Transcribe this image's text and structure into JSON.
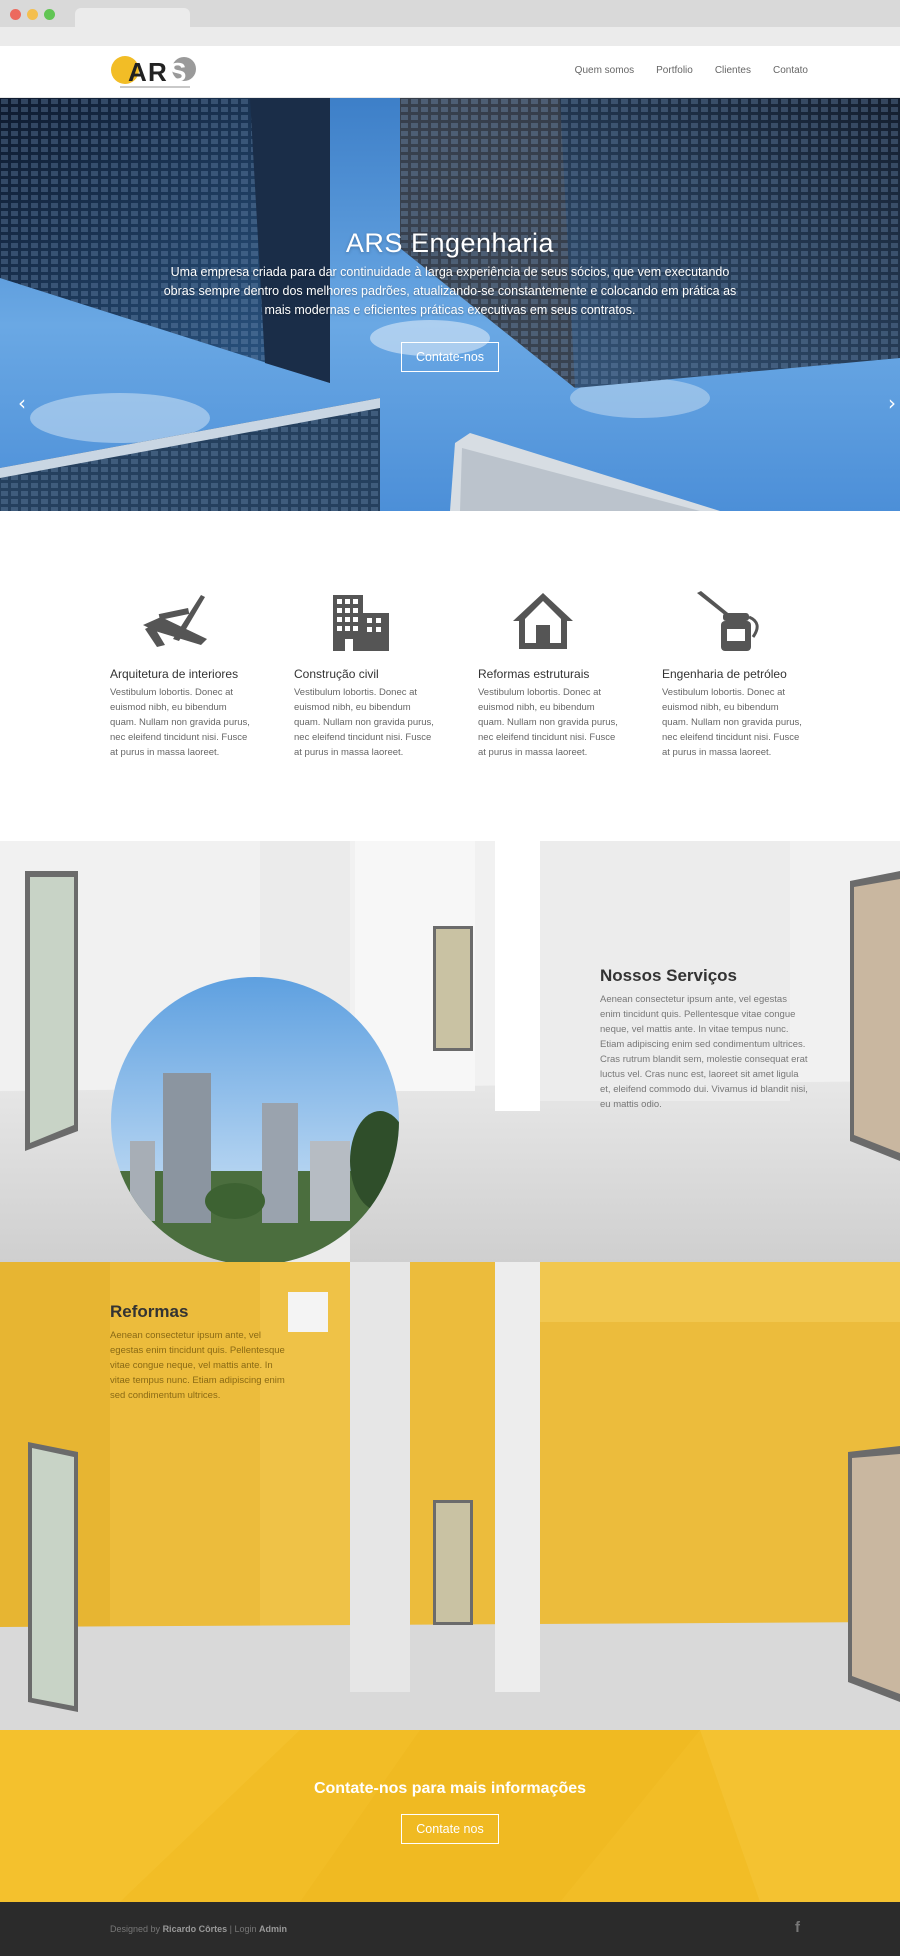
{
  "colors": {
    "accent": "#f2bd26",
    "footer_bg": "#2b2b2b",
    "sky": "#4a8fd6"
  },
  "nav": {
    "items": [
      "Quem somos",
      "Portfolio",
      "Clientes",
      "Contato"
    ]
  },
  "hero": {
    "title": "ARS Engenharia",
    "text": "Uma empresa criada para dar continuidade à larga experiência de seus sócios, que vem executando obras sempre dentro dos melhores padrões, atualizando-se constantemente e colocando em prática as mais modernas e eficientes práticas executivas em seus contratos.",
    "button": "Contate-nos",
    "prev_arrow": "‹",
    "next_arrow": "›"
  },
  "services": [
    {
      "icon": "tools-icon",
      "title": "Arquitetura de interiores",
      "text": "Vestibulum lobortis. Donec at euismod nibh, eu bibendum quam. Nullam non gravida purus, nec eleifend tincidunt nisi. Fusce at purus in massa laoreet."
    },
    {
      "icon": "building-icon",
      "title": "Construção civil",
      "text": "Vestibulum lobortis. Donec at euismod nibh, eu bibendum quam. Nullam non gravida purus, nec eleifend tincidunt nisi. Fusce at purus in massa laoreet."
    },
    {
      "icon": "house-icon",
      "title": "Reformas estruturais",
      "text": "Vestibulum lobortis. Donec at euismod nibh, eu bibendum quam. Nullam non gravida purus, nec eleifend tincidunt nisi. Fusce at purus in massa laoreet."
    },
    {
      "icon": "oil-can-icon",
      "title": "Engenharia de petróleo",
      "text": "Vestibulum lobortis. Donec at euismod nibh, eu bibendum quam. Nullam non gravida purus, nec eleifend tincidunt nisi. Fusce at purus in massa laoreet."
    }
  ],
  "nossos_servicos": {
    "title": "Nossos Serviços",
    "text": "Aenean consectetur ipsum ante, vel egestas enim tincidunt quis. Pellentesque vitae congue neque, vel mattis ante. In vitae tempus nunc. Etiam adipiscing enim sed condimentum ultrices. Cras rutrum blandit sem, molestie consequat erat luctus vel. Cras nunc est, laoreet sit amet ligula et, eleifend commodo dui. Vivamus id blandit nisi, eu mattis odio."
  },
  "reformas": {
    "title": "Reformas",
    "text": "Aenean consectetur ipsum ante, vel egestas enim tincidunt quis. Pellentesque vitae congue neque, vel mattis ante. In vitae tempus nunc. Etiam adipiscing enim sed condimentum ultrices."
  },
  "cta": {
    "title": "Contate-nos para mais informações",
    "button": "Contate nos"
  },
  "footer": {
    "designed_by": "Designed by",
    "designer": "Ricardo Côrtes",
    "separator": "|",
    "login": "Login",
    "admin": "Admin",
    "social_icon": "facebook-icon",
    "social_glyph": "f"
  }
}
